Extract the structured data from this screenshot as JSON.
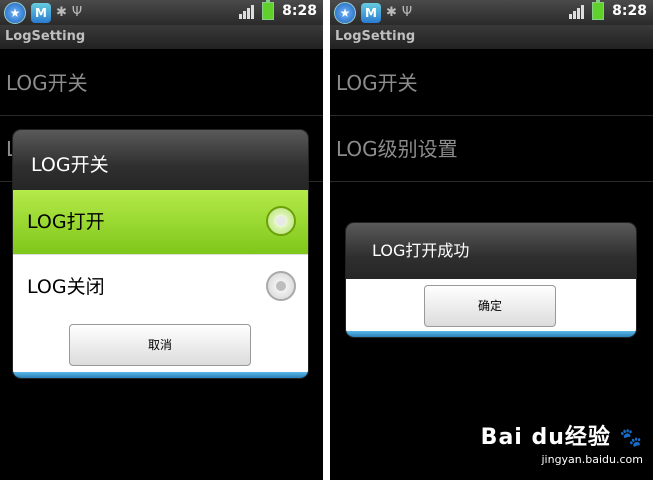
{
  "status_bar": {
    "time": "8:28"
  },
  "app": {
    "title": "LogSetting"
  },
  "left": {
    "list_items": [
      "LOG开关",
      "L"
    ],
    "dialog": {
      "title": "LOG开关",
      "options": [
        {
          "label": "LOG打开",
          "selected": true
        },
        {
          "label": "LOG关闭",
          "selected": false
        }
      ],
      "cancel_label": "取消"
    }
  },
  "right": {
    "list_items": [
      "LOG开关",
      "LOG级别设置"
    ],
    "dialog": {
      "message": "LOG打开成功",
      "ok_label": "确定"
    }
  },
  "watermark": {
    "logo": "Bai du经验",
    "sub": "jingyan.baidu.com"
  },
  "colors": {
    "selected_green": "#9ad83a",
    "dialog_accent_blue": "#3a9ad8",
    "battery_green": "#5fd12a"
  },
  "icons": [
    "star-app-icon",
    "m-app-icon",
    "android-debug-icon",
    "usb-icon",
    "signal-icon",
    "battery-icon",
    "paw-icon"
  ]
}
